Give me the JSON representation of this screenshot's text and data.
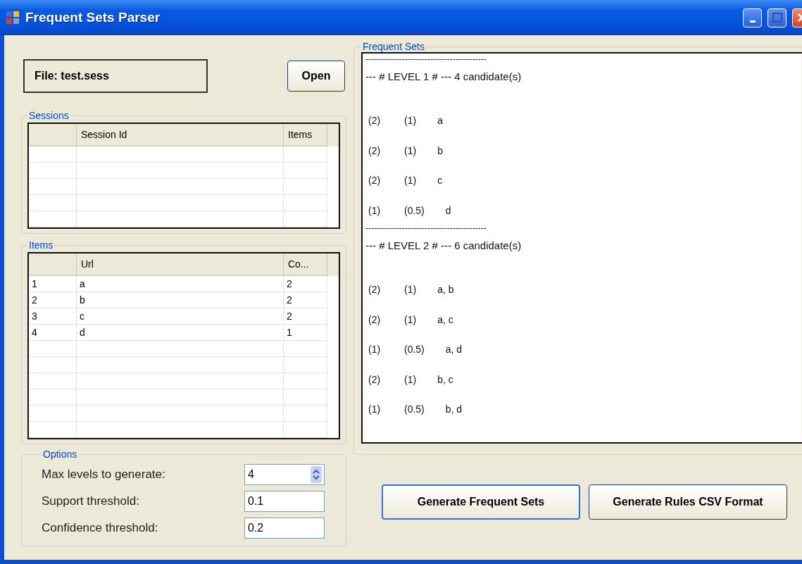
{
  "window": {
    "title": "Frequent Sets Parser"
  },
  "file": {
    "label": "File: test.sess"
  },
  "open_button": "Open",
  "sessions": {
    "title": "Sessions",
    "columns": [
      "",
      "Session Id",
      "Items"
    ]
  },
  "items": {
    "title": "Items",
    "columns": [
      "",
      "Url",
      "Co..."
    ],
    "rows": [
      [
        "1",
        "a",
        "2"
      ],
      [
        "2",
        "b",
        "2"
      ],
      [
        "3",
        "c",
        "2"
      ],
      [
        "4",
        "d",
        "1"
      ]
    ]
  },
  "options": {
    "title": "Options",
    "fields": [
      {
        "kind": "spin",
        "label": "Max  levels to generate:",
        "value": "4"
      },
      {
        "kind": "text",
        "label": "Support threshold:",
        "value": "0.1"
      },
      {
        "kind": "text",
        "label": "Confidence threshold:",
        "value": "0.2"
      }
    ]
  },
  "frequent_sets": {
    "title": "Frequent Sets",
    "lines": [
      {
        "kind": "separator",
        "text": "-------------------------------------------"
      },
      {
        "kind": "header",
        "text": "--- # LEVEL 1 # ---  4 candidate(s)"
      },
      {
        "kind": "blank"
      },
      {
        "kind": "row",
        "cells": [
          "(2)",
          "(1)",
          "a"
        ]
      },
      {
        "kind": "row",
        "cells": [
          "(2)",
          "(1)",
          "b"
        ]
      },
      {
        "kind": "row",
        "cells": [
          "(2)",
          "(1)",
          "c"
        ]
      },
      {
        "kind": "row",
        "cells": [
          "(1)",
          "(0.5)",
          "d"
        ]
      },
      {
        "kind": "separator",
        "text": "-------------------------------------------"
      },
      {
        "kind": "header",
        "text": "--- # LEVEL 2 # ---  6 candidate(s)"
      },
      {
        "kind": "blank"
      },
      {
        "kind": "row",
        "cells": [
          "(2)",
          "(1)",
          "a, b"
        ]
      },
      {
        "kind": "row",
        "cells": [
          "(2)",
          "(1)",
          "a, c"
        ]
      },
      {
        "kind": "row",
        "cells": [
          "(1)",
          "(0.5)",
          "a, d"
        ]
      },
      {
        "kind": "row",
        "cells": [
          "(2)",
          "(1)",
          "b, c"
        ]
      },
      {
        "kind": "row",
        "cells": [
          "(1)",
          "(0.5)",
          "b, d"
        ]
      }
    ]
  },
  "buttons": [
    {
      "label": "Generate Frequent Sets",
      "focused": true
    },
    {
      "label": "Generate Rules CSV Format",
      "focused": false
    }
  ]
}
